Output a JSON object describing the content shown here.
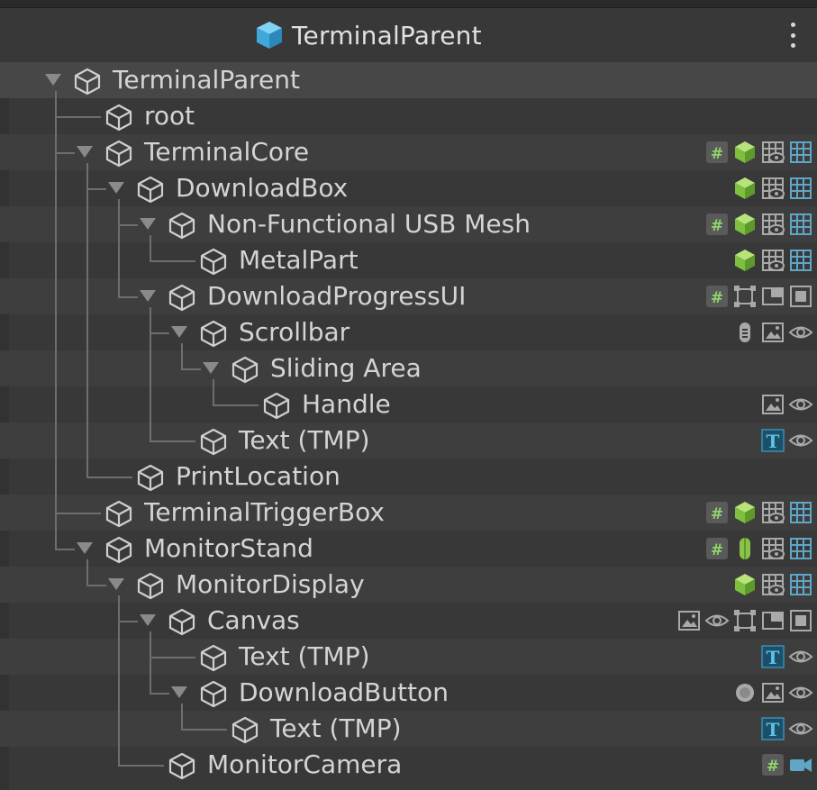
{
  "header": {
    "title": "TerminalParent",
    "icon": "prefab-cube-icon",
    "menu_icon": "kebab-menu-icon"
  },
  "colors": {
    "background": "#383838",
    "row_alt": "#3e3e3e",
    "root_row": "#474747",
    "script_green": "#6f8f3c",
    "mesh_green": "#8bc34a",
    "grid_blue": "#5fa6c7"
  },
  "rows": [
    {
      "label": "TerminalParent",
      "depth": 0,
      "expanded": true,
      "icons": []
    },
    {
      "label": "root",
      "depth": 1,
      "expanded": false,
      "icons": []
    },
    {
      "label": "TerminalCore",
      "depth": 1,
      "expanded": true,
      "icons": [
        "script-icon",
        "mesh-renderer-icon",
        "visibility-grid-icon",
        "grid-icon"
      ]
    },
    {
      "label": "DownloadBox",
      "depth": 2,
      "expanded": true,
      "icons": [
        "mesh-renderer-icon",
        "visibility-grid-icon",
        "grid-icon"
      ]
    },
    {
      "label": "Non-Functional USB Mesh",
      "depth": 3,
      "expanded": true,
      "icons": [
        "script-icon",
        "mesh-renderer-icon",
        "visibility-grid-icon",
        "grid-icon"
      ],
      "checked": true
    },
    {
      "label": "MetalPart",
      "depth": 4,
      "expanded": false,
      "icons": [
        "mesh-renderer-icon",
        "visibility-grid-icon",
        "grid-icon"
      ]
    },
    {
      "label": "DownloadProgressUI",
      "depth": 3,
      "expanded": true,
      "icons": [
        "script-icon",
        "rect-transform-icon",
        "canvas-icon",
        "canvas-scaler-icon"
      ]
    },
    {
      "label": "Scrollbar",
      "depth": 4,
      "expanded": true,
      "icons": [
        "scrollbar-icon",
        "image-icon",
        "eye-icon"
      ]
    },
    {
      "label": "Sliding Area",
      "depth": 5,
      "expanded": true,
      "icons": []
    },
    {
      "label": "Handle",
      "depth": 6,
      "expanded": false,
      "icons": [
        "image-icon",
        "eye-icon"
      ]
    },
    {
      "label": "Text (TMP)",
      "depth": 4,
      "expanded": false,
      "icons": [
        "text-tmp-icon",
        "eye-icon"
      ]
    },
    {
      "label": "PrintLocation",
      "depth": 2,
      "expanded": false,
      "icons": []
    },
    {
      "label": "TerminalTriggerBox",
      "depth": 1,
      "expanded": false,
      "icons": [
        "script-icon",
        "mesh-renderer-icon",
        "visibility-grid-icon",
        "grid-icon"
      ]
    },
    {
      "label": "MonitorStand",
      "depth": 1,
      "expanded": true,
      "icons": [
        "script-icon",
        "capsule-collider-icon",
        "visibility-grid-icon",
        "grid-icon"
      ]
    },
    {
      "label": "MonitorDisplay",
      "depth": 2,
      "expanded": true,
      "icons": [
        "mesh-renderer-icon",
        "visibility-grid-icon",
        "grid-icon"
      ]
    },
    {
      "label": "Canvas",
      "depth": 3,
      "expanded": true,
      "icons": [
        "image-icon",
        "eye-icon",
        "rect-transform-icon",
        "canvas-icon",
        "canvas-scaler-icon"
      ]
    },
    {
      "label": "Text (TMP)",
      "depth": 4,
      "expanded": false,
      "icons": [
        "text-tmp-icon",
        "eye-icon"
      ]
    },
    {
      "label": "DownloadButton",
      "depth": 4,
      "expanded": true,
      "icons": [
        "button-icon",
        "image-icon",
        "eye-icon"
      ]
    },
    {
      "label": "Text (TMP)",
      "depth": 5,
      "expanded": false,
      "icons": [
        "text-tmp-icon",
        "eye-icon"
      ]
    },
    {
      "label": "MonitorCamera",
      "depth": 3,
      "expanded": false,
      "icons": [
        "script-icon",
        "camera-icon"
      ]
    }
  ]
}
